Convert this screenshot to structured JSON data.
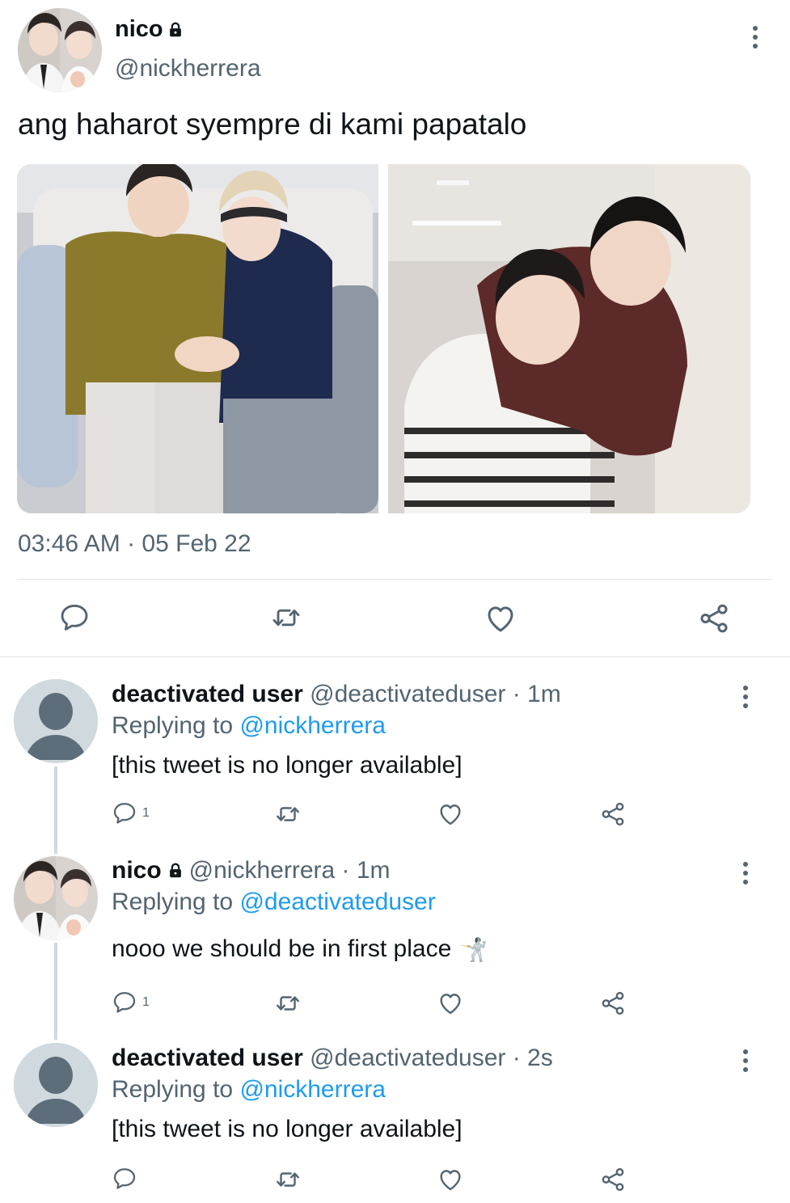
{
  "main_tweet": {
    "author_name": "nico",
    "author_handle": "@nickherrera",
    "text": "ang haharot syempre di kami papatalo",
    "timestamp": "03:46 AM · 05 Feb 22",
    "icons": [
      "lock-icon",
      "more-icon",
      "reply-icon",
      "retweet-icon",
      "like-icon",
      "share-icon"
    ]
  },
  "replies": [
    {
      "name": "deactivated user",
      "handle_time": "@deactivateduser · 1m",
      "replying_prefix": "Replying to ",
      "replying_to": "@nickherrera",
      "text": "[this tweet is no longer available]",
      "reply_count": "1"
    },
    {
      "name": "nico",
      "handle_time": "@nickherrera · 1m",
      "replying_prefix": "Replying to ",
      "replying_to": "@deactivateduser",
      "text": "nooo we should be in first place",
      "emoji": "🤺",
      "reply_count": "1"
    },
    {
      "name": "deactivated user",
      "handle_time": "@deactivateduser · 2s",
      "replying_prefix": "Replying to ",
      "replying_to": "@nickherrera",
      "text": "[this tweet is no longer available]",
      "reply_count": ""
    }
  ],
  "colors": {
    "text_primary": "#0f1419",
    "text_secondary": "#536471",
    "link": "#1d9bf0",
    "divider": "#e1e6ea",
    "default_avatar": "#cfd9de"
  }
}
